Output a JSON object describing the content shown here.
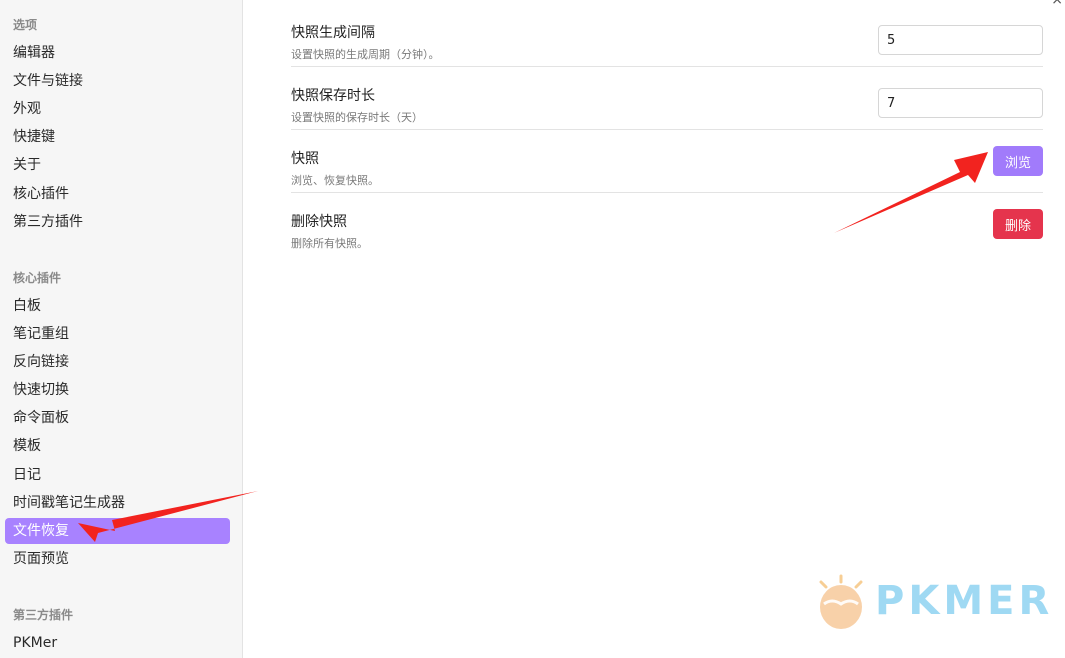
{
  "sidebar": {
    "sections": [
      {
        "title": "选项",
        "items": [
          "编辑器",
          "文件与链接",
          "外观",
          "快捷键",
          "关于",
          "核心插件",
          "第三方插件"
        ]
      },
      {
        "title": "核心插件",
        "items": [
          "白板",
          "笔记重组",
          "反向链接",
          "快速切换",
          "命令面板",
          "模板",
          "日记",
          "时间戳笔记生成器",
          "文件恢复",
          "页面预览"
        ]
      },
      {
        "title": "第三方插件",
        "items": [
          "PKMer"
        ]
      }
    ],
    "active_item": "文件恢复"
  },
  "settings": [
    {
      "name": "快照生成间隔",
      "desc": "设置快照的生成周期（分钟）。",
      "control": "input",
      "value": "5"
    },
    {
      "name": "快照保存时长",
      "desc": "设置快照的保存时长（天）",
      "control": "input",
      "value": "7"
    },
    {
      "name": "快照",
      "desc": "浏览、恢复快照。",
      "control": "button",
      "label": "浏览"
    },
    {
      "name": "删除快照",
      "desc": "删除所有快照。",
      "control": "button",
      "label": "删除"
    }
  ],
  "close_icon": "×",
  "watermark": {
    "text": "PKMER"
  },
  "colors": {
    "accent": "#a882ff",
    "danger": "#e5344d",
    "arrow": "#f2231f"
  }
}
